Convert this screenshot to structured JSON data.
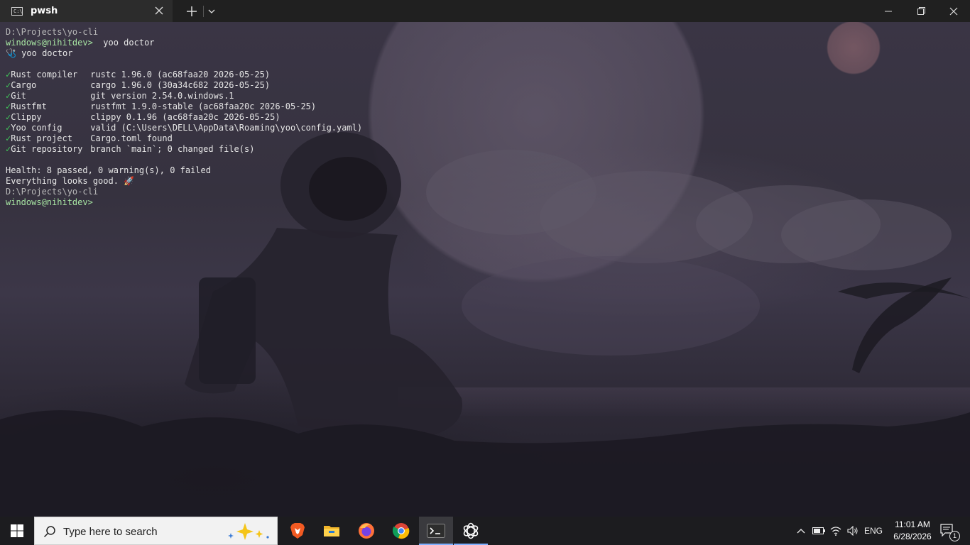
{
  "window": {
    "tab_title": "pwsh",
    "tab_icon_text": "C:\\"
  },
  "terminal": {
    "lines": [
      {
        "type": "path",
        "text": "D:\\Projects\\yo-cli"
      },
      {
        "type": "prompt",
        "prompt": "windows@nihitdev>",
        "command": "  yoo doctor"
      },
      {
        "type": "plain",
        "text": "🩺 yoo doctor"
      },
      {
        "type": "blank",
        "text": ""
      },
      {
        "type": "check",
        "name": "Rust compiler",
        "value": "rustc 1.96.0 (ac68faa20 2026-05-25)"
      },
      {
        "type": "check",
        "name": "Cargo",
        "value": "cargo 1.96.0 (30a34c682 2026-05-25)"
      },
      {
        "type": "check",
        "name": "Git",
        "value": "git version 2.54.0.windows.1"
      },
      {
        "type": "check",
        "name": "Rustfmt",
        "value": "rustfmt 1.9.0-stable (ac68faa20c 2026-05-25)"
      },
      {
        "type": "check",
        "name": "Clippy",
        "value": "clippy 0.1.96 (ac68faa20c 2026-05-25)"
      },
      {
        "type": "check",
        "name": "Yoo config",
        "value": "valid (C:\\Users\\DELL\\AppData\\Roaming\\yoo\\config.yaml)"
      },
      {
        "type": "check",
        "name": "Rust project",
        "value": "Cargo.toml found"
      },
      {
        "type": "check",
        "name": "Git repository",
        "value": "branch `main`; 0 changed file(s)"
      },
      {
        "type": "blank",
        "text": ""
      },
      {
        "type": "plain",
        "text": "Health: 8 passed, 0 warning(s), 0 failed"
      },
      {
        "type": "plain",
        "text": "Everything looks good. 🚀"
      },
      {
        "type": "path",
        "text": "D:\\Projects\\yo-cli"
      },
      {
        "type": "prompt",
        "prompt": "windows@nihitdev>",
        "command": ""
      }
    ],
    "check_mark": "✓"
  },
  "taskbar": {
    "search_placeholder": "Type here to search",
    "apps": [
      {
        "name": "brave-icon"
      },
      {
        "name": "file-explorer-icon"
      },
      {
        "name": "firefox-icon"
      },
      {
        "name": "chrome-icon"
      },
      {
        "name": "terminal-icon",
        "active": true
      },
      {
        "name": "chatgpt-icon"
      }
    ],
    "language": "ENG",
    "time": "11:01 AM",
    "date": "6/28/2026",
    "notification_count": "1"
  },
  "colors": {
    "prompt": "#a6e3a1",
    "check": "#3fcf5a",
    "titlebar": "#202020",
    "taskbar": "#1c1c1f"
  }
}
